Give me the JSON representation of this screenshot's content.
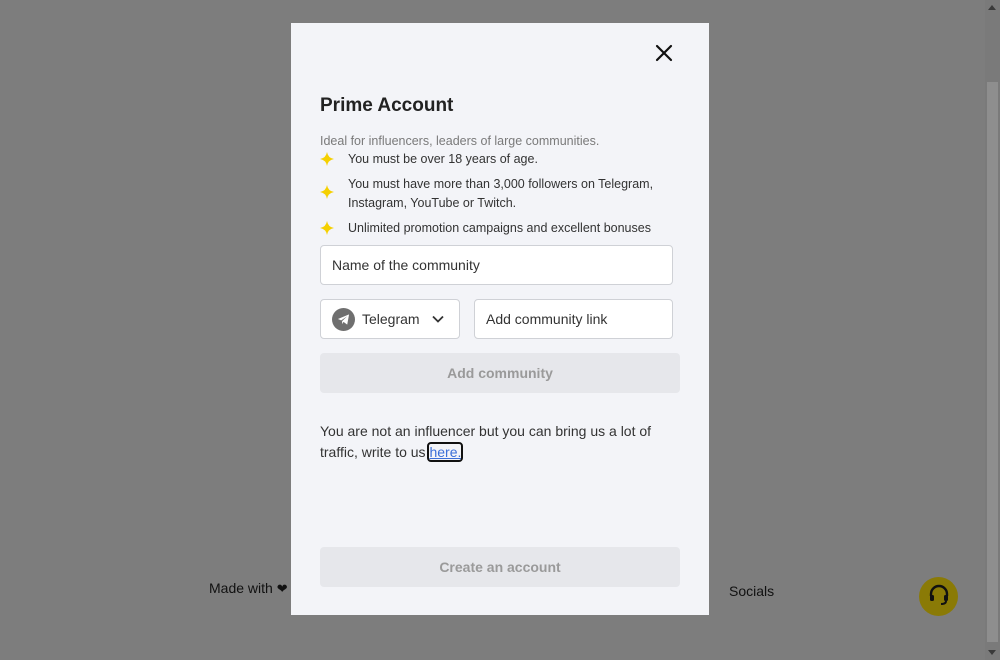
{
  "background": {
    "footer_left": "Made with",
    "heart_glyph": "❤",
    "footer_right": "Socials",
    "support_icon": "headset-icon",
    "accent_color": "#8a7a06"
  },
  "modal": {
    "title": "Prime Account",
    "subtitle": "Ideal for influencers, leaders of large communities.",
    "requirements": [
      "You must be over 18 years of age.",
      "You must have more than 3,000 followers on Telegram, Instagram, YouTube or Twitch.",
      "Unlimited promotion campaigns and excellent bonuses"
    ],
    "star_color": "#f5d000",
    "name_placeholder": "Name of the community",
    "platform": {
      "selected": "Telegram",
      "icon": "telegram-icon"
    },
    "link_placeholder": "Add community link",
    "add_button": "Add community",
    "note_text": "You are not an influencer but you can bring us a lot of traffic, write to us ",
    "note_link": "here.",
    "create_button": "Create an account"
  }
}
